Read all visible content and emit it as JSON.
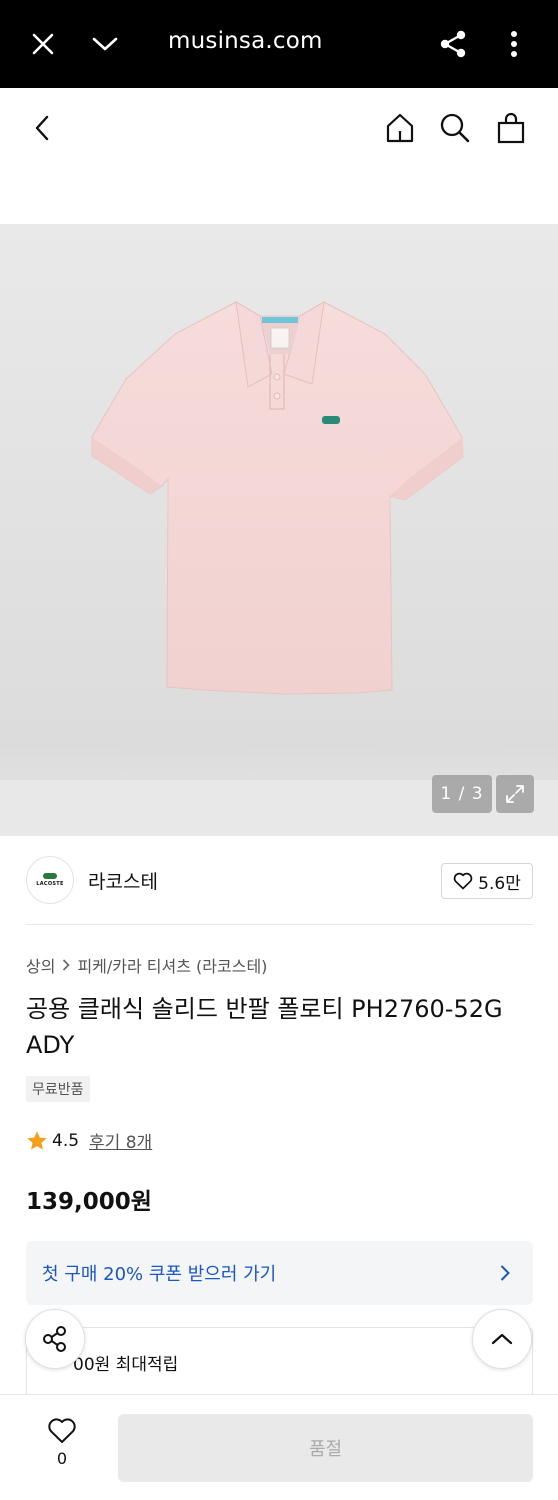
{
  "browser": {
    "url": "musinsa.com",
    "icons": [
      "close-icon",
      "chevron-down-icon",
      "share-icon",
      "more-vertical-icon"
    ]
  },
  "header": {
    "icons": [
      "back-icon",
      "home-icon",
      "search-icon",
      "cart-icon"
    ]
  },
  "gallery": {
    "counter": "1 / 3",
    "product_color": "#f3d6d6",
    "icons": [
      "expand-icon"
    ]
  },
  "brand": {
    "name": "라코스테",
    "logo_text": "LACOSTE",
    "likes": "5.6만"
  },
  "product": {
    "breadcrumb": [
      "상의",
      "피케/카라 티셔츠 (라코스테)"
    ],
    "title": "공용 클래식 솔리드 반팔 폴로티 PH2760-52G ADY",
    "badge": "무료반품",
    "rating": "4.5",
    "review_label": "후기 8개",
    "price": "139,000원"
  },
  "coupon": {
    "label": "첫 구매 20% 쿠폰 받으러 가기",
    "accent": "#1a56c4"
  },
  "points": {
    "text": "00원 최대적립"
  },
  "bottom": {
    "wish_count": "0",
    "button_label": "품절"
  }
}
